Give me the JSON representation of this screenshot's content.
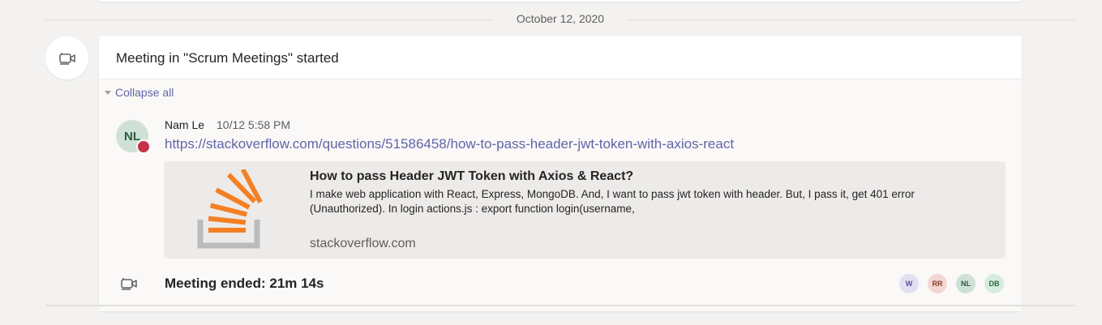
{
  "date_divider": {
    "label": "October 12, 2020"
  },
  "card": {
    "title": "Meeting in \"Scrum Meetings\" started",
    "collapse_label": "Collapse all"
  },
  "message": {
    "avatar_initials": "NL",
    "author": "Nam Le",
    "timestamp": "10/12 5:58 PM",
    "link": "https://stackoverflow.com/questions/51586458/how-to-pass-header-jwt-token-with-axios-react"
  },
  "preview": {
    "title": "How to pass Header JWT Token with Axios & React?",
    "description": "I make web application with React, Express, MongoDB. And, I want to pass jwt token with header. But, I pass it, get 401 error (Unauthorized). In login actions.js : export function login(username,",
    "domain": "stackoverflow.com",
    "thumbnail_icon": "stackoverflow-logo"
  },
  "meeting_end": {
    "label": "Meeting ended: 21m 14s",
    "icon": "video-camera-icon"
  },
  "participants": [
    {
      "initials": "W",
      "bg": "#e3dff2",
      "fg": "#5b4e9a"
    },
    {
      "initials": "RR",
      "bg": "#f5d7d2",
      "fg": "#8a3b2e"
    },
    {
      "initials": "NL",
      "bg": "#cfe1d6",
      "fg": "#2c5b41"
    },
    {
      "initials": "DB",
      "bg": "#d5ecdf",
      "fg": "#2f6b48"
    }
  ],
  "colors": {
    "accent": "#6264a7",
    "presence_busy": "#c4314b",
    "background": "#f3f2f1"
  }
}
